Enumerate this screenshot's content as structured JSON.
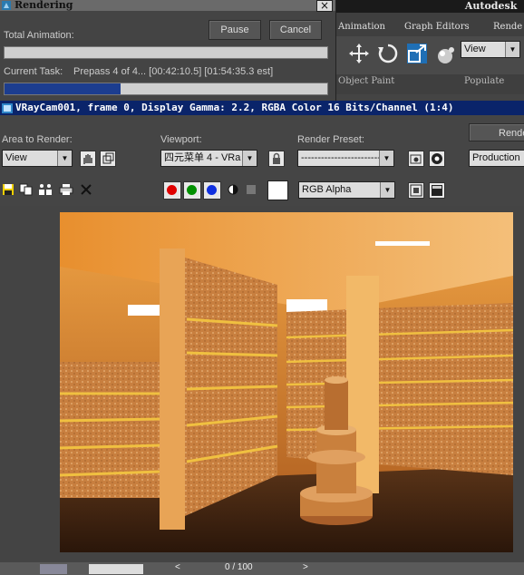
{
  "render_dialog": {
    "title": "Rendering",
    "close_glyph": "×",
    "pause_label": "Pause",
    "cancel_label": "Cancel",
    "total_animation_label": "Total Animation:",
    "total_progress": 0.0,
    "current_task_label": "Current Task:",
    "current_task_value": "Prepass 4 of 4... [00:42:10.5] [01:54:35.3 est]",
    "task_progress": 0.36
  },
  "max_panel": {
    "brand": "Autodesk",
    "menus": [
      "Animation",
      "Graph Editors",
      "Rende"
    ],
    "view_dropdown": "View",
    "sub_labels": [
      "Object Paint",
      "Populate"
    ]
  },
  "frame_window": {
    "title": "VRayCam001, frame 0, Display Gamma: 2.2, RGBA Color 16 Bits/Channel (1:4)",
    "area_label": "Area to Render:",
    "area_value": "View",
    "viewport_label": "Viewport:",
    "viewport_value": "四元菜单 4 - VRa",
    "preset_label": "Render Preset:",
    "preset_value": "-------------------------",
    "render_button": "Rende",
    "production_value": "Production",
    "channel_value": "RGB Alpha",
    "channel_colors": [
      "#e00000",
      "#009000",
      "#1030e0"
    ]
  },
  "status_bar": {
    "frame_counter": "0 / 100",
    "prev_glyph": "<",
    "next_glyph": ">"
  }
}
